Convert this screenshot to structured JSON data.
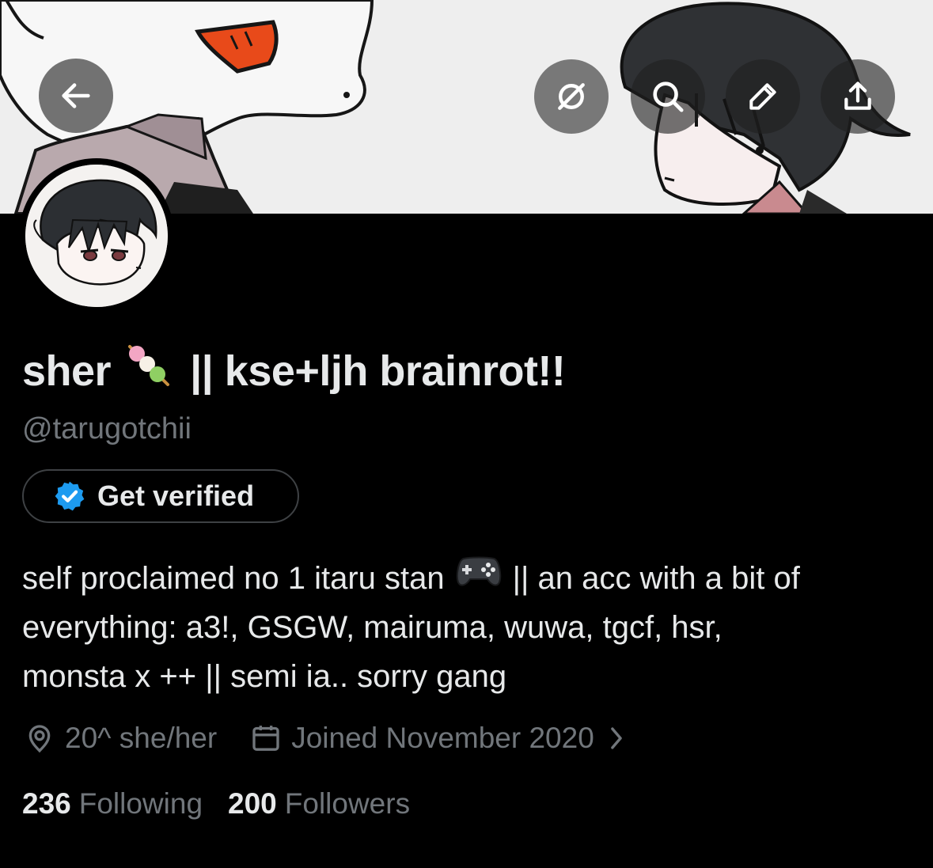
{
  "header": {
    "back_icon": "arrow-left-icon",
    "grok_icon": "grok-icon",
    "search_icon": "search-icon",
    "edit_icon": "pencil-icon",
    "share_icon": "share-icon"
  },
  "profile": {
    "display_name_prefix": "sher",
    "display_name_emoji": "dango-emoji",
    "display_name_suffix": "|| kse+ljh brainrot!!",
    "handle": "@tarugotchii",
    "verify_button_label": "Get verified",
    "bio": {
      "line1_before": "self proclaimed no 1 itaru stan",
      "line1_emoji": "video-game-emoji",
      "line1_after": "|| an acc with a bit of",
      "line2": "everything: a3!, GSGW, mairuma, wuwa, tgcf, hsr,",
      "line3": "monsta x ++ || semi ia.. sorry gang"
    },
    "location": "20^ she/her",
    "joined": "Joined November 2020",
    "following_count": "236",
    "following_label": "Following",
    "followers_count": "200",
    "followers_label": "Followers"
  },
  "colors": {
    "background": "#000000",
    "primary_text": "#e7e9ea",
    "secondary_text": "#71767b",
    "verified_blue": "#1d9bf0",
    "button_border": "#3e4144"
  }
}
